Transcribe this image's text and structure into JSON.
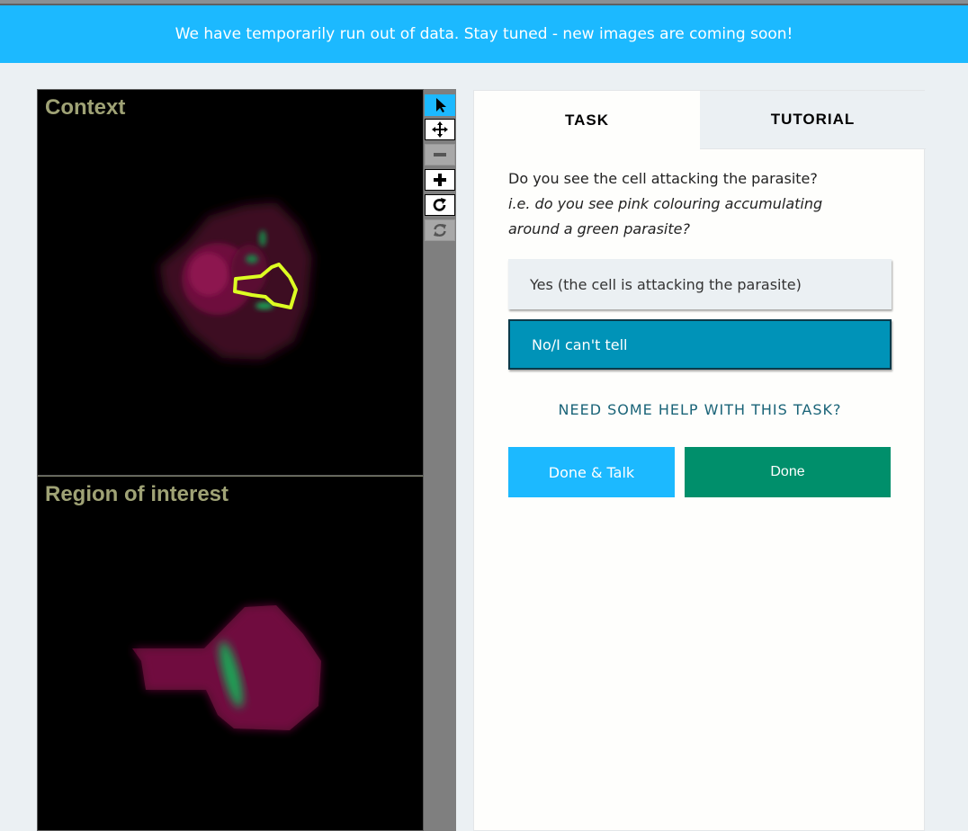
{
  "banner": {
    "message": "We have temporarily run out of data. Stay tuned - new images are coming soon!"
  },
  "viewer": {
    "frames": [
      {
        "title": "Context"
      },
      {
        "title": "Region of interest"
      }
    ],
    "tools": [
      {
        "icon": "pointer-icon",
        "state": "active"
      },
      {
        "icon": "move-icon",
        "state": "enabled"
      },
      {
        "icon": "zoom-out-icon",
        "state": "disabled"
      },
      {
        "icon": "zoom-in-icon",
        "state": "enabled"
      },
      {
        "icon": "rotate-icon",
        "state": "enabled"
      },
      {
        "icon": "reset-icon",
        "state": "disabled"
      }
    ],
    "colors": {
      "cell": "#8a1050",
      "parasite": "#1ea054",
      "outline": "#ddff22"
    }
  },
  "panel": {
    "tabs": {
      "task": "TASK",
      "tutorial": "TUTORIAL"
    },
    "question": {
      "text": "Do you see the cell attacking the parasite?",
      "hint_line1": "i.e. do you see pink colouring accumulating",
      "hint_line2": "around a green parasite?"
    },
    "answers": {
      "yes": "Yes (the cell is attacking the parasite)",
      "no": "No/I can't tell"
    },
    "selected_answer": "no",
    "help_link": "NEED SOME HELP WITH THIS TASK?",
    "buttons": {
      "done_talk": "Done & Talk",
      "done": "Done"
    }
  },
  "theme": {
    "accent": "#1cb9ff",
    "selected": "#0093b8",
    "done": "#008f6b",
    "title": "#9fa275"
  }
}
